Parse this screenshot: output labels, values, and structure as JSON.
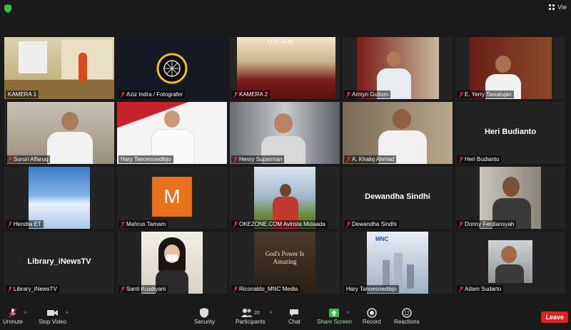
{
  "top": {
    "view_label": "Vie"
  },
  "participants": [
    {
      "name": "KAMERA 1",
      "active": true
    },
    {
      "name": "Aziz Indra / Fotografer"
    },
    {
      "name": "KAMERA 2"
    },
    {
      "name": "Armyn Gultom"
    },
    {
      "name": "E. Yerry Tawalujan"
    },
    {
      "name": "Sururi Alfaruq"
    },
    {
      "name": "Hary Tanoesoedibjo"
    },
    {
      "name": "Henry Suparman"
    },
    {
      "name": "A. Khaliq Ahmad"
    },
    {
      "name": "Heri Budianto",
      "display": "Heri Budianto"
    },
    {
      "name": "Hendra ET"
    },
    {
      "name": "Mahrus Tamam",
      "avatar_letter": "M"
    },
    {
      "name": "OKEZONE.COM Avirista Midaada"
    },
    {
      "name": "Dewandha Sindhi",
      "display": "Dewandha Sindhi"
    },
    {
      "name": "Donny Ferdiansyah"
    },
    {
      "name": "Library_iNewsTV",
      "display": "Library_iNewsTV"
    },
    {
      "name": "Santi Kusdiyani"
    },
    {
      "name": "Riconaldo_MNC Media"
    },
    {
      "name": "Hary Tanoesoedibjo"
    },
    {
      "name": "Adam Sudarto"
    }
  ],
  "tile_texts": {
    "cam2_clock": "12:41 49:59",
    "gods_power": "God's Power Is Amazing",
    "mnc_logo": "MNC"
  },
  "toolbar": {
    "unmute": "Unmute",
    "stop_video": "Stop Video",
    "security": "Security",
    "participants": "Participants",
    "participants_count": "20",
    "chat": "Chat",
    "share_screen": "Share Screen",
    "record": "Record",
    "reactions": "Reactions",
    "leave": "Leave"
  },
  "colors": {
    "active_outline": "#c7e53a",
    "leave": "#d9261c",
    "mute_red": "#e0302a",
    "share_green": "#2fbf5b",
    "avatar_orange": "#e8711a"
  }
}
